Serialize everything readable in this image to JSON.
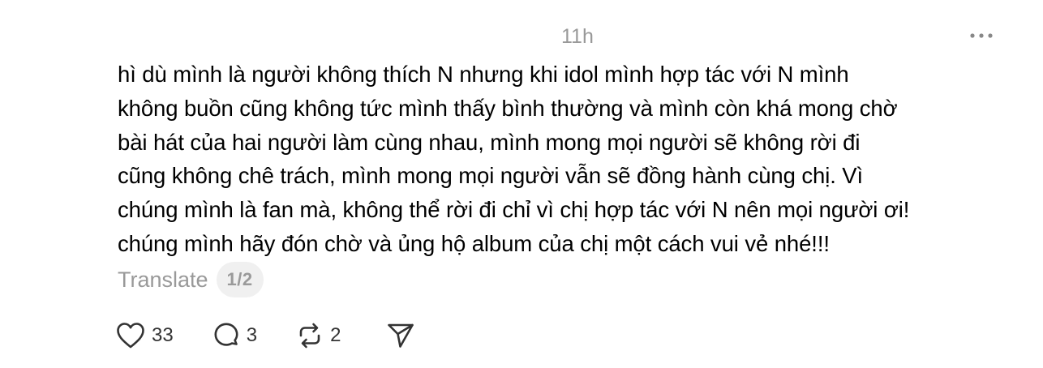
{
  "post": {
    "timestamp": "11h",
    "body": "hì dù mình là người không thích N nhưng khi idol mình hợp tác với N mình\nkhông buồn cũng không tức mình thấy bình thường và mình còn khá mong chờ\nbài hát của hai người làm cùng nhau, mình mong mọi người sẽ không rời đi\ncũng không chê trách, mình mong mọi người vẫn sẽ đồng hành cùng chị. Vì\nchúng mình là fan mà, không thể rời đi chỉ vì chị hợp tác với N nên mọi người ơi!\nchúng mình hãy đón chờ và ủng hộ album của chị một cách vui vẻ nhé!!!",
    "translate_label": "Translate",
    "page_indicator": "1/2"
  },
  "actions": {
    "like_count": "33",
    "reply_count": "3",
    "repost_count": "2"
  },
  "icons": {
    "more": "more-horizontal-icon",
    "like": "heart-icon",
    "reply": "comment-bubble-icon",
    "repost": "repost-icon",
    "share": "send-icon"
  },
  "colors": {
    "text": "#000000",
    "muted": "#999999",
    "icon": "#333333",
    "pill_bg": "#f0f0f0"
  }
}
